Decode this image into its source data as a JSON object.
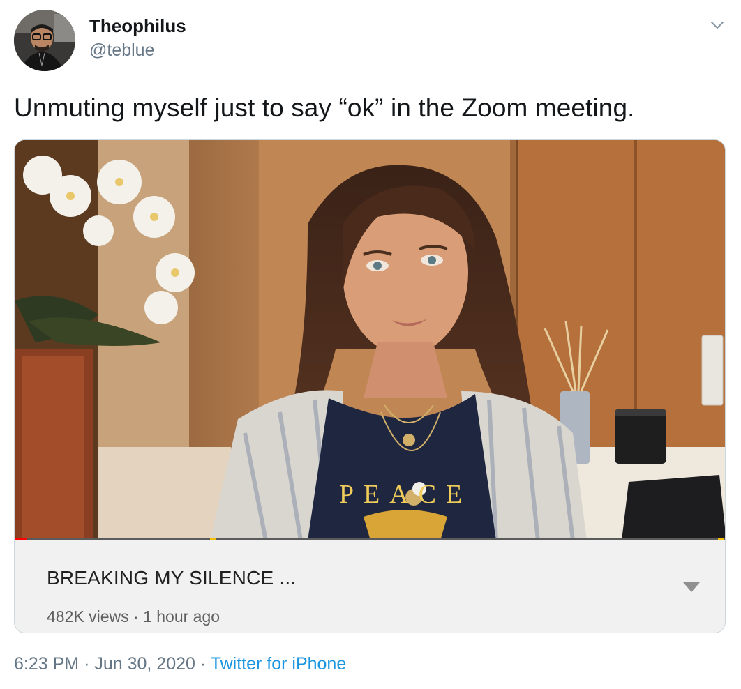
{
  "user": {
    "name": "Theophilus",
    "handle": "@teblue",
    "avatar_icon": "profile-photo"
  },
  "tweet": {
    "text": "Unmuting myself just to say “ok” in the Zoom meeting."
  },
  "card": {
    "title": "BREAKING MY SILENCE ...",
    "views": "482K views",
    "separator": "·",
    "age": "1 hour ago",
    "shirt_text": "PEACE",
    "progress_fraction": 0.018,
    "progress_color": "#ff0000",
    "ad_marker_color": "#f5c000"
  },
  "footer": {
    "time": "6:23 PM",
    "separator": "·",
    "date": "Jun 30, 2020",
    "source": "Twitter for iPhone"
  },
  "colors": {
    "text": "#14171a",
    "secondary": "#657786",
    "link": "#1b95e0",
    "card_border": "#ccd6dd"
  }
}
